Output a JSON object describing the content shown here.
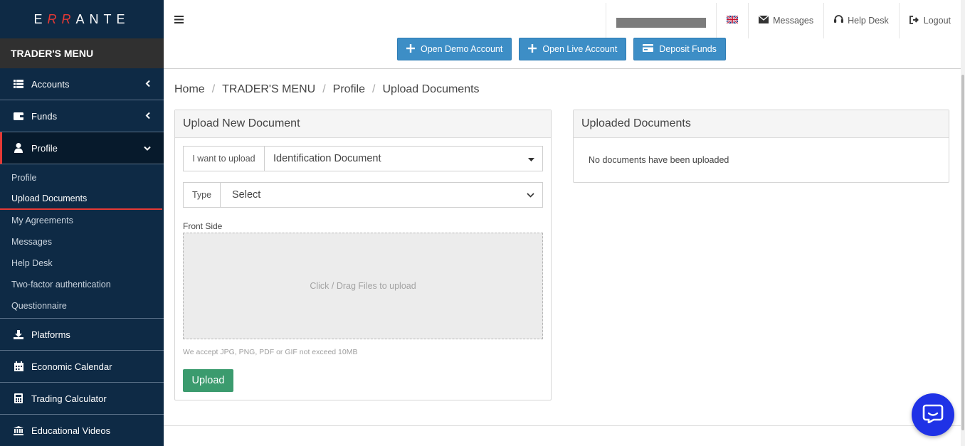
{
  "brand": {
    "letters_left": "E",
    "letters_accent": "RR",
    "letters_right": "ANTE"
  },
  "sidebar": {
    "menu_title": "TRADER'S MENU",
    "items_top": [
      {
        "label": "Accounts",
        "icon": "list-icon"
      },
      {
        "label": "Funds",
        "icon": "wallet-icon"
      },
      {
        "label": "Profile",
        "icon": "user-icon"
      }
    ],
    "profile_sub": [
      {
        "label": "Profile"
      },
      {
        "label": "Upload Documents"
      },
      {
        "label": "My Agreements"
      },
      {
        "label": "Messages"
      },
      {
        "label": "Help Desk"
      },
      {
        "label": "Two-factor authentication"
      },
      {
        "label": "Questionnaire"
      }
    ],
    "items_bottom": [
      {
        "label": "Platforms",
        "icon": "download-icon"
      },
      {
        "label": "Economic Calendar",
        "icon": "calendar-icon"
      },
      {
        "label": "Trading Calculator",
        "icon": "calculator-icon"
      },
      {
        "label": "Educational Videos",
        "icon": "institution-icon"
      }
    ]
  },
  "topbar": {
    "messages_label": "Messages",
    "helpdesk_label": "Help Desk",
    "logout_label": "Logout",
    "language_icon": "uk-flag-icon"
  },
  "actions": {
    "open_demo": "Open Demo Account",
    "open_live": "Open Live Account",
    "deposit": "Deposit Funds"
  },
  "breadcrumb": {
    "home": "Home",
    "menu": "TRADER'S MENU",
    "profile": "Profile",
    "current": "Upload Documents",
    "separator": "/"
  },
  "upload_panel": {
    "title": "Upload New Document",
    "want_label": "I want to upload",
    "want_value": "Identification Document",
    "type_label": "Type",
    "type_value": "Select",
    "front_side_label": "Front Side",
    "dropzone_text": "Click / Drag Files to upload",
    "help_text": "We accept JPG, PNG, PDF or GIF not exceed 10MB",
    "upload_button": "Upload"
  },
  "uploaded_panel": {
    "title": "Uploaded Documents",
    "empty_text": "No documents have been uploaded"
  },
  "colors": {
    "sidebar_bg": "#0e2a45",
    "accent_red": "#e53935",
    "button_blue": "#3d8ec6",
    "upload_green": "#3b9b6e",
    "chat_blue": "#1f32e6"
  }
}
